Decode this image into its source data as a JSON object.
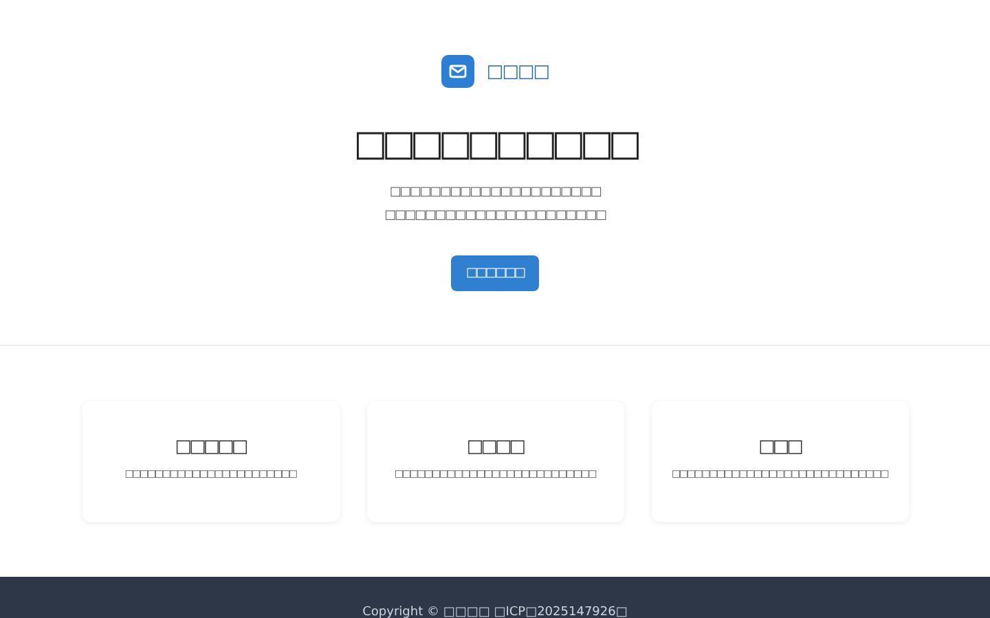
{
  "brand": {
    "name": "□□□□"
  },
  "hero": {
    "title": "□□□□□□□□□□",
    "lines": [
      "□□□□□□□□□□□□□□□□□□□□□",
      "□□□□□□□□□□□□□□□□□□□□□□"
    ],
    "button": "□□□□□□"
  },
  "features": [
    {
      "title": "□□□□□",
      "text": "□□□□□□□□□□□□□□□□□□□□□□□"
    },
    {
      "title": "□□□□",
      "text": "□□□□□□□□□□□□□□□□□□□□□□□□□□□"
    },
    {
      "title": "□□□",
      "text": "□□□□□□□□□□□□□□□□□□□□□□□□□□□□□"
    }
  ],
  "footer": {
    "text": "Copyright © □□□□  □ICP□2025147926□"
  }
}
